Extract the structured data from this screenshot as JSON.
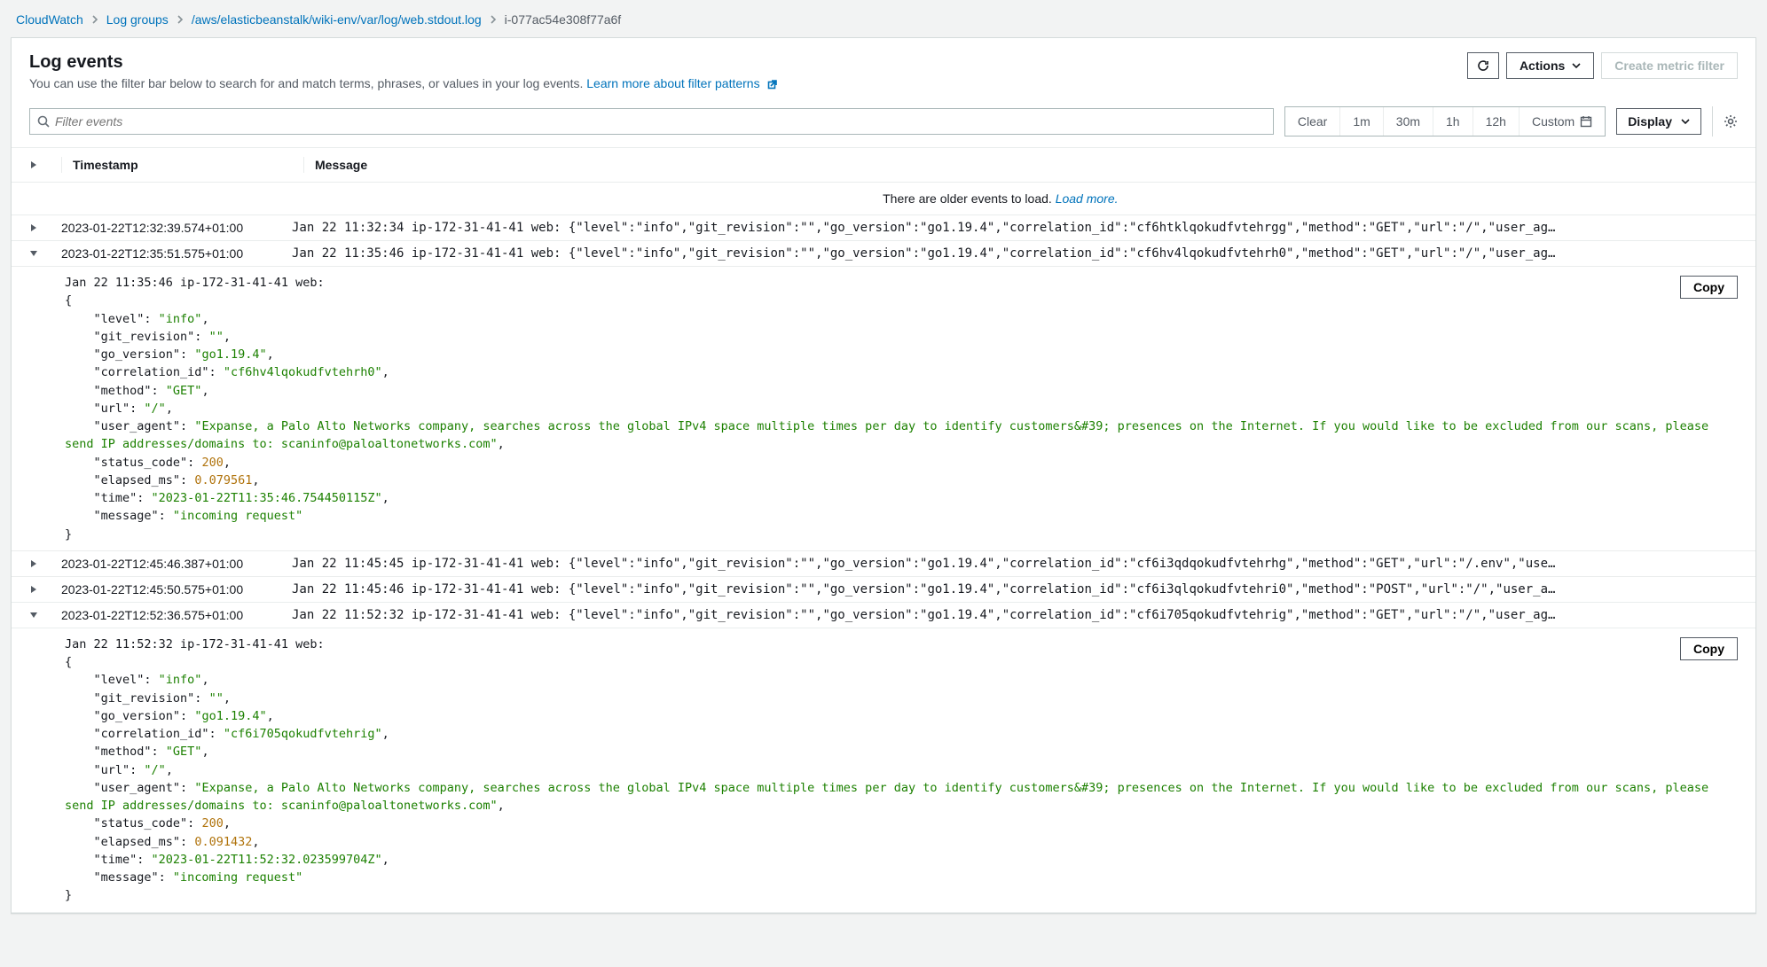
{
  "breadcrumb": {
    "items": [
      {
        "label": "CloudWatch"
      },
      {
        "label": "Log groups"
      },
      {
        "label": "/aws/elasticbeanstalk/wiki-env/var/log/web.stdout.log"
      },
      {
        "label": "i-077ac54e308f77a6f",
        "current": true
      }
    ]
  },
  "page": {
    "title": "Log events",
    "subtitle": "You can use the filter bar below to search for and match terms, phrases, or values in your log events.",
    "learn_more": "Learn more about filter patterns"
  },
  "actions": {
    "refresh_aria": "Refresh",
    "actions_label": "Actions",
    "create_metric_filter": "Create metric filter"
  },
  "search": {
    "placeholder": "Filter events"
  },
  "time_ranges": {
    "clear": "Clear",
    "r1": "1m",
    "r2": "30m",
    "r3": "1h",
    "r4": "12h",
    "custom": "Custom"
  },
  "display_label": "Display",
  "table": {
    "col_timestamp": "Timestamp",
    "col_message": "Message",
    "older_text": "There are older events to load.",
    "older_link": "Load more.",
    "copy_label": "Copy",
    "rows": [
      {
        "expanded": false,
        "timestamp": "2023-01-22T12:32:39.574+01:00",
        "message": "Jan 22 11:32:34 ip-172-31-41-41 web: {\"level\":\"info\",\"git_revision\":\"\",\"go_version\":\"go1.19.4\",\"correlation_id\":\"cf6htklqokudfvtehrgg\",\"method\":\"GET\",\"url\":\"/\",\"user_ag…"
      },
      {
        "expanded": true,
        "timestamp": "2023-01-22T12:35:51.575+01:00",
        "message": "Jan 22 11:35:46 ip-172-31-41-41 web: {\"level\":\"info\",\"git_revision\":\"\",\"go_version\":\"go1.19.4\",\"correlation_id\":\"cf6hv4lqokudfvtehrh0\",\"method\":\"GET\",\"url\":\"/\",\"user_ag…",
        "detail_prefix": "Jan 22 11:35:46 ip-172-31-41-41 web:",
        "detail": {
          "level": "info",
          "git_revision": "",
          "go_version": "go1.19.4",
          "correlation_id": "cf6hv4lqokudfvtehrh0",
          "method": "GET",
          "url": "/",
          "user_agent": "Expanse, a Palo Alto Networks company, searches across the global IPv4 space multiple times per day to identify customers&#39; presences on the Internet. If you would like to be excluded from our scans, please send IP addresses/domains to: scaninfo@paloaltonetworks.com",
          "status_code": 200,
          "elapsed_ms": 0.079561,
          "time": "2023-01-22T11:35:46.754450115Z",
          "message": "incoming request"
        }
      },
      {
        "expanded": false,
        "timestamp": "2023-01-22T12:45:46.387+01:00",
        "message": "Jan 22 11:45:45 ip-172-31-41-41 web: {\"level\":\"info\",\"git_revision\":\"\",\"go_version\":\"go1.19.4\",\"correlation_id\":\"cf6i3qdqokudfvtehrhg\",\"method\":\"GET\",\"url\":\"/.env\",\"use…"
      },
      {
        "expanded": false,
        "timestamp": "2023-01-22T12:45:50.575+01:00",
        "message": "Jan 22 11:45:46 ip-172-31-41-41 web: {\"level\":\"info\",\"git_revision\":\"\",\"go_version\":\"go1.19.4\",\"correlation_id\":\"cf6i3qlqokudfvtehri0\",\"method\":\"POST\",\"url\":\"/\",\"user_a…"
      },
      {
        "expanded": true,
        "timestamp": "2023-01-22T12:52:36.575+01:00",
        "message": "Jan 22 11:52:32 ip-172-31-41-41 web: {\"level\":\"info\",\"git_revision\":\"\",\"go_version\":\"go1.19.4\",\"correlation_id\":\"cf6i705qokudfvtehrig\",\"method\":\"GET\",\"url\":\"/\",\"user_ag…",
        "detail_prefix": "Jan 22 11:52:32 ip-172-31-41-41 web:",
        "detail": {
          "level": "info",
          "git_revision": "",
          "go_version": "go1.19.4",
          "correlation_id": "cf6i705qokudfvtehrig",
          "method": "GET",
          "url": "/",
          "user_agent": "Expanse, a Palo Alto Networks company, searches across the global IPv4 space multiple times per day to identify customers&#39; presences on the Internet. If you would like to be excluded from our scans, please send IP addresses/domains to: scaninfo@paloaltonetworks.com",
          "status_code": 200,
          "elapsed_ms": 0.091432,
          "time": "2023-01-22T11:52:32.023599704Z",
          "message": "incoming request"
        }
      }
    ]
  }
}
